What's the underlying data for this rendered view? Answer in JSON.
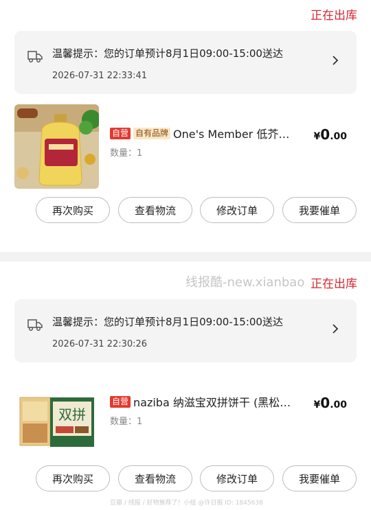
{
  "orders": [
    {
      "status": "正在出库",
      "notice_text": "温馨提示：您的订单预计8月1日09:00-15:00送达",
      "notice_time": "2026-07-31 22:33:41",
      "badge_self": "自营",
      "badge_brand": "自有品牌",
      "product_name": "One's Member 低芥…",
      "quantity": "数量：1",
      "price_symbol": "¥",
      "price_int": "0",
      "price_dec": ".00",
      "buttons": [
        "再次购买",
        "查看物流",
        "修改订单",
        "我要催单"
      ]
    },
    {
      "status": "正在出库",
      "notice_text": "温馨提示：您的订单预计8月1日09:00-15:00送达",
      "notice_time": "2026-07-31 22:30:26",
      "badge_self": "自营",
      "product_name": "naziba 纳滋宝双拼饼干 (黑松…",
      "quantity": "数量：1",
      "price_symbol": "¥",
      "price_int": "0",
      "price_dec": ".00",
      "buttons": [
        "再次购买",
        "查看物流",
        "修改订单",
        "我要催单"
      ],
      "package_label": "双拼"
    }
  ],
  "watermark": "线报酷-new.xianbao",
  "footer_watermark": "豆瓣 / 线报 / 好物推荐了！小组 @许日报 ID: 1845638"
}
